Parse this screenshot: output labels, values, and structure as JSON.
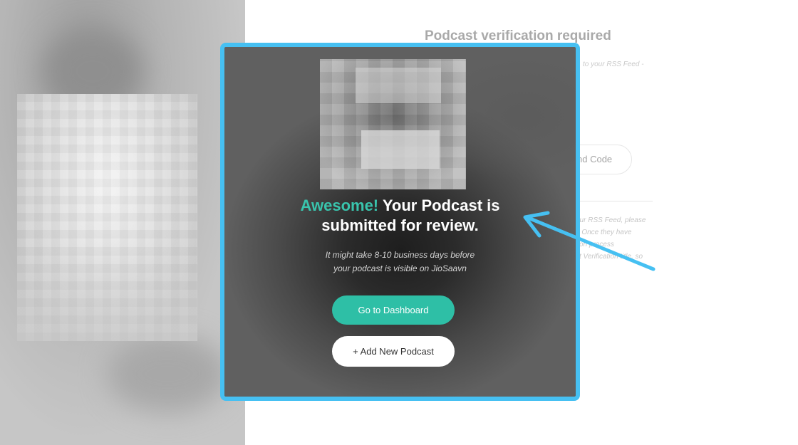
{
  "background_page": {
    "title": "Podcast verification required",
    "rss_fragment": "to your RSS Feed -",
    "send_code_label": "nd Code",
    "paragraph_lines": [
      "our RSS Feed, please",
      "t. Once they have",
      "tion process",
      "st Verification title, so"
    ]
  },
  "modal": {
    "headline_accent": "Awesome!",
    "headline_line1_rest": " Your Podcast is",
    "headline_line2": "submitted for review.",
    "subtext_line1": "It might take 8-10 business days before",
    "subtext_line2": "your podcast is visible on JioSaavn",
    "primary_button": "Go to Dashboard",
    "secondary_button": "+ Add New Podcast"
  },
  "colors": {
    "highlight_border": "#46c0f2",
    "accent_teal": "#2ebfa6",
    "headline_accent": "#39c4ad",
    "arrow": "#46c0f2"
  },
  "icons": {
    "annotation": "arrow-icon"
  }
}
